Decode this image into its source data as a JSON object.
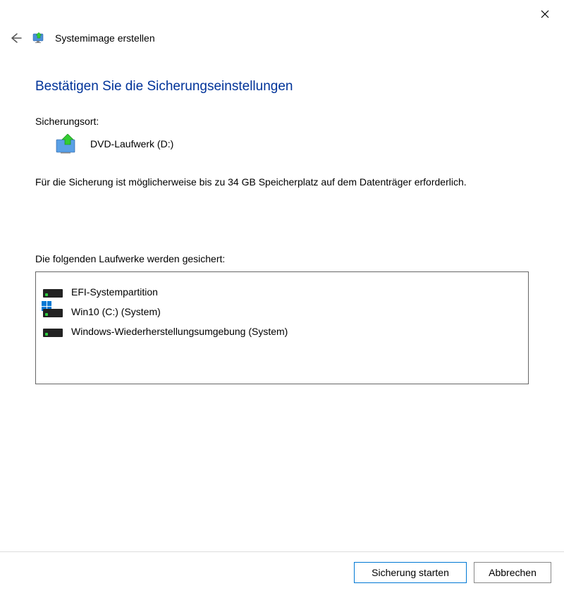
{
  "window": {
    "title": "Systemimage erstellen"
  },
  "page": {
    "heading": "Bestätigen Sie die Sicherungseinstellungen",
    "backup_location_label": "Sicherungsort:",
    "backup_location_value": "DVD-Laufwerk (D:)",
    "space_info": "Für die Sicherung ist möglicherweise bis zu 34 GB Speicherplatz auf dem Datenträger erforderlich.",
    "drives_label": "Die folgenden Laufwerke werden gesichert:"
  },
  "drives": [
    {
      "name": "EFI-Systempartition",
      "windows_badge": false
    },
    {
      "name": "Win10 (C:) (System)",
      "windows_badge": true
    },
    {
      "name": "Windows-Wiederherstellungsumgebung (System)",
      "windows_badge": false
    }
  ],
  "buttons": {
    "start": "Sicherung starten",
    "cancel": "Abbrechen"
  }
}
